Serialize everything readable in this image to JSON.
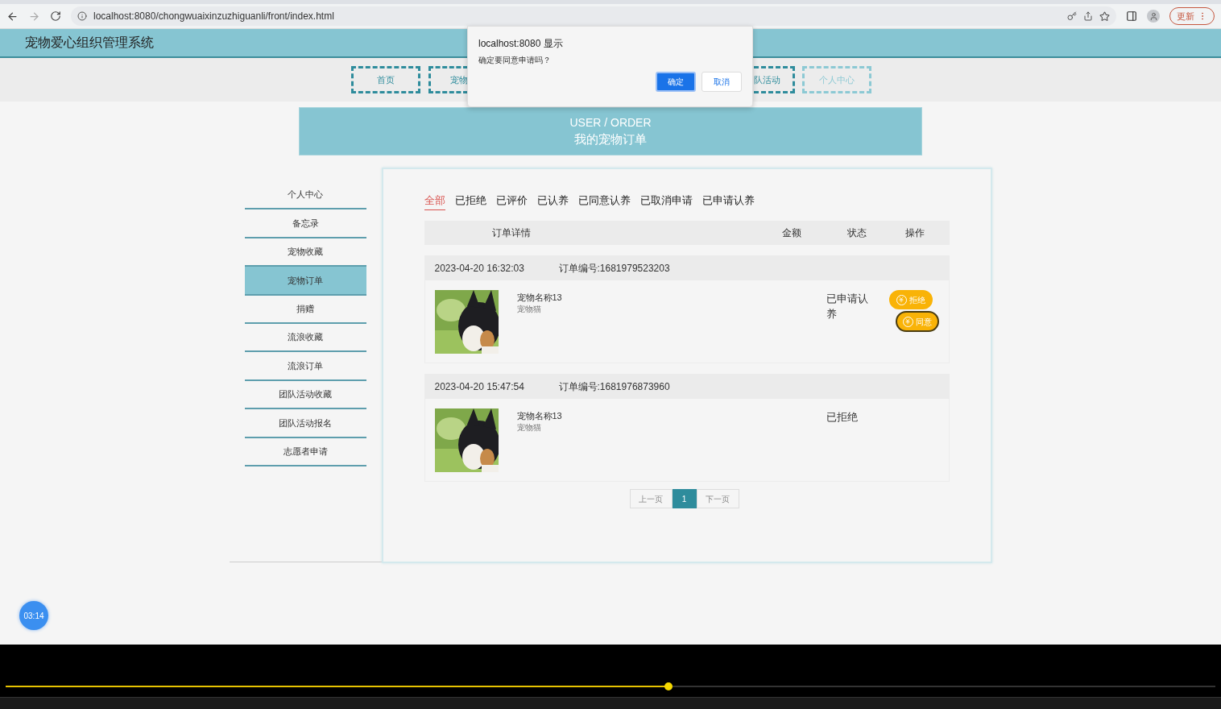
{
  "browser": {
    "url": "localhost:8080/chongwuaixinzuzhiguanli/front/index.html",
    "update_button": "更新"
  },
  "header": {
    "title": "宠物爱心组织管理系统"
  },
  "nav": [
    {
      "label": "首页",
      "selected": false,
      "kind": "full"
    },
    {
      "label": "宠物",
      "selected": false,
      "kind": "cut-right"
    },
    {
      "label": "队活动",
      "selected": false,
      "kind": "cut-left"
    },
    {
      "label": "个人中心",
      "selected": true,
      "kind": "full"
    }
  ],
  "banner": {
    "title": "USER / ORDER",
    "subtitle": "我的宠物订单"
  },
  "sidebar": [
    {
      "label": "个人中心",
      "selected": false
    },
    {
      "label": "备忘录",
      "selected": false
    },
    {
      "label": "宠物收藏",
      "selected": false
    },
    {
      "label": "宠物订单",
      "selected": true
    },
    {
      "label": "捐赠",
      "selected": false
    },
    {
      "label": "流浪收藏",
      "selected": false
    },
    {
      "label": "流浪订单",
      "selected": false
    },
    {
      "label": "团队活动收藏",
      "selected": false
    },
    {
      "label": "团队活动报名",
      "selected": false
    },
    {
      "label": "志愿者申请",
      "selected": false
    }
  ],
  "tabs": [
    {
      "label": "全部",
      "selected": true
    },
    {
      "label": "已拒绝",
      "selected": false
    },
    {
      "label": "已评价",
      "selected": false
    },
    {
      "label": "已认养",
      "selected": false
    },
    {
      "label": "已同意认养",
      "selected": false
    },
    {
      "label": "已取消申请",
      "selected": false
    },
    {
      "label": "已申请认养",
      "selected": false
    }
  ],
  "table": {
    "columns": [
      "订单详情",
      "金额",
      "状态",
      "操作"
    ]
  },
  "orders": [
    {
      "time": "2023-04-20 16:32:03",
      "order_no": "订单编号:1681979523203",
      "pet_name": "宠物名称13",
      "pet_type": "宠物猫",
      "status": "已申请认养",
      "actions": [
        {
          "label": "拒绝",
          "focused": false
        },
        {
          "label": "同意",
          "focused": true
        }
      ]
    },
    {
      "time": "2023-04-20 15:47:54",
      "order_no": "订单编号:1681976873960",
      "pet_name": "宠物名称13",
      "pet_type": "宠物猫",
      "status": "已拒绝"
    }
  ],
  "pagination": {
    "prev": "上一页",
    "pages": [
      {
        "label": "1",
        "selected": true
      }
    ],
    "next": "下一页"
  },
  "dialog": {
    "title": "localhost:8080 显示",
    "message": "确定要同意申请吗？",
    "buttons": [
      {
        "label": "确定",
        "primary": true
      },
      {
        "label": "取消",
        "primary": false
      }
    ]
  },
  "timer_badge": "03:14",
  "player": {
    "progress": {
      "level": 0.548
    }
  }
}
